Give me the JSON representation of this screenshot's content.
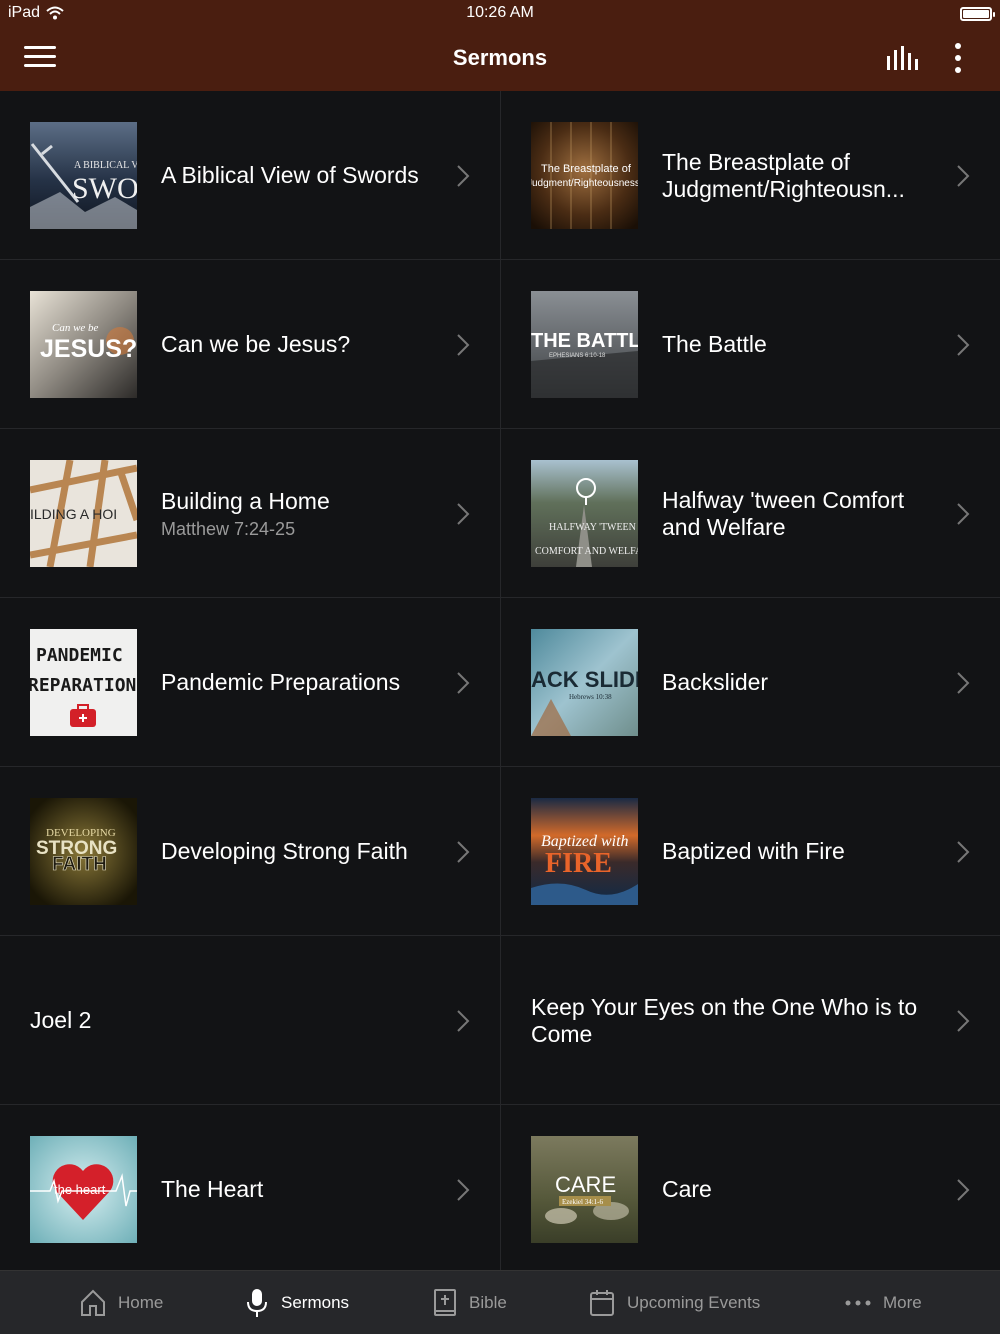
{
  "status": {
    "device": "iPad",
    "time": "10:26 AM"
  },
  "header": {
    "title": "Sermons",
    "menu_icon": "hamburger-menu-icon",
    "stats_icon": "equalizer-bars-icon",
    "more_icon": "vertical-ellipsis-icon"
  },
  "sermons": [
    {
      "title": "A Biblical View of Swords",
      "subtitle": "",
      "thumb_text": "SWOR",
      "thumb_small": "A BIBLICAL VIE"
    },
    {
      "title": "The Breastplate of Judgment/Righteousn...",
      "subtitle": "",
      "thumb_text": "The Breastplate of",
      "thumb_small": "Judgment/Righteousness"
    },
    {
      "title": "Can we be Jesus?",
      "subtitle": "",
      "thumb_text": "JESUS?",
      "thumb_small": "Can we be"
    },
    {
      "title": "The Battle",
      "subtitle": "",
      "thumb_text": "THE BATTLE",
      "thumb_small": "EPHESIANS 6:10-18"
    },
    {
      "title": "Building a Home",
      "subtitle": "Matthew 7:24-25",
      "thumb_text": "ILDING A HOI",
      "thumb_small": ""
    },
    {
      "title": "Halfway 'tween Comfort and Welfare",
      "subtitle": "",
      "thumb_text": "HALFWAY 'TWEEN",
      "thumb_small": "COMFORT AND WELFARE"
    },
    {
      "title": "Pandemic Preparations",
      "subtitle": "",
      "thumb_text": "PANDEMIC",
      "thumb_small": "REPARATION"
    },
    {
      "title": "Backslider",
      "subtitle": "",
      "thumb_text": "ACK SLIDE",
      "thumb_small": "Hebrews 10:38"
    },
    {
      "title": "Developing Strong Faith",
      "subtitle": "",
      "thumb_text": "STRONG",
      "thumb_small": "DEVELOPING",
      "thumb_text2": "FAITH"
    },
    {
      "title": "Baptized with Fire",
      "subtitle": "",
      "thumb_text": "FIRE",
      "thumb_small": "Baptized with"
    },
    {
      "title": "Joel 2",
      "subtitle": ""
    },
    {
      "title": "Keep Your Eyes on the One Who is to Come",
      "subtitle": ""
    },
    {
      "title": "The Heart",
      "subtitle": "",
      "thumb_text": "the heart",
      "thumb_small": ""
    },
    {
      "title": "Care",
      "subtitle": "",
      "thumb_text": "CARE",
      "thumb_small": "Ezekiel 34:1-6"
    }
  ],
  "tabs": [
    {
      "label": "Home",
      "icon": "home-icon",
      "active": false
    },
    {
      "label": "Sermons",
      "icon": "microphone-icon",
      "active": true
    },
    {
      "label": "Bible",
      "icon": "bible-book-icon",
      "active": false
    },
    {
      "label": "Upcoming Events",
      "icon": "calendar-icon",
      "active": false
    },
    {
      "label": "More",
      "icon": "horizontal-ellipsis-icon",
      "active": false
    }
  ],
  "colors": {
    "header_bg": "#4a1e10",
    "page_bg": "#121315",
    "tabbar_bg": "#26272a",
    "divider": "#26272a"
  }
}
